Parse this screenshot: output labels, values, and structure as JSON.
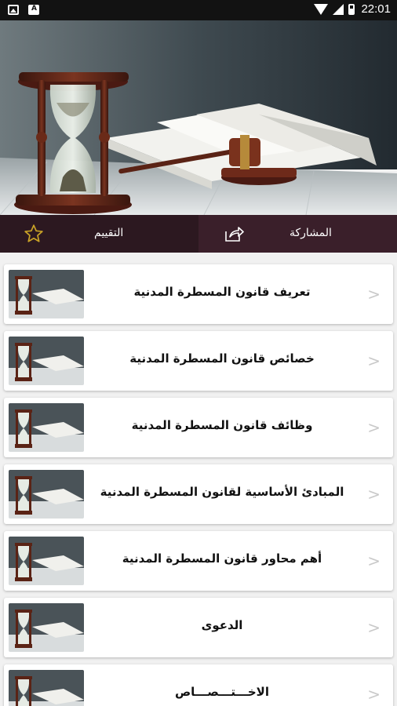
{
  "status_bar": {
    "time": "22:01",
    "icons": [
      "image-notification-icon",
      "a-notification-icon",
      "wifi-icon",
      "signal-icon",
      "battery-icon"
    ]
  },
  "hero": {
    "image": "hourglass-gavel-books-banner"
  },
  "tabs": {
    "share_label": "المشاركة",
    "rate_label": "التقييم",
    "share_icon": "share-icon",
    "rate_icon": "star-icon"
  },
  "colors": {
    "tab_rate_bg": "#2c1820",
    "tab_share_bg": "#3a1f2a",
    "list_bg": "#f1f1f1"
  },
  "items": [
    {
      "title": "تعريف قانون المسطرة المدنية"
    },
    {
      "title": "خصائص قانون المسطرة المدنية"
    },
    {
      "title": "وظائف قانون المسطرة المدنية"
    },
    {
      "title": "المبادئ الأساسية لقانون المسطرة المدنية"
    },
    {
      "title": "أهم محاور قانون المسطرة المدنية"
    },
    {
      "title": "الدعوى"
    },
    {
      "title": "الاخـــتـــصـــاص"
    }
  ],
  "chevron": ">"
}
